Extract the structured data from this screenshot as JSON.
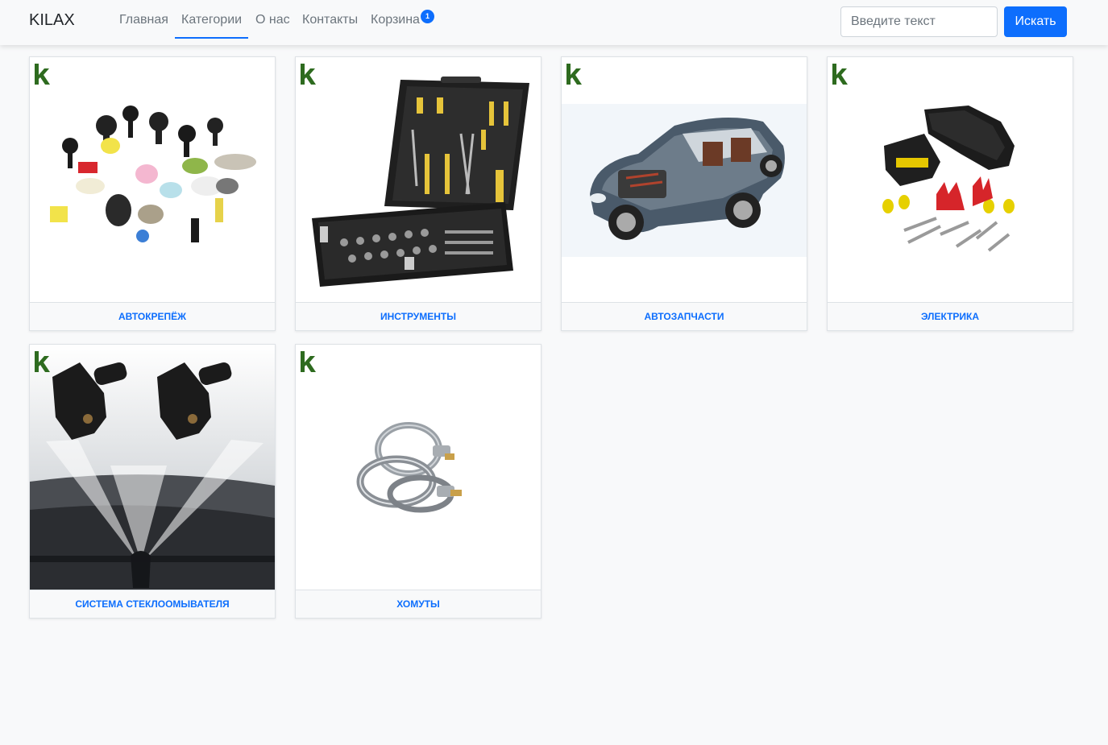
{
  "brand": "KILAX",
  "nav": {
    "home": "Главная",
    "categories": "Категории",
    "about": "О нас",
    "contacts": "Контакты",
    "cart": "Корзина",
    "cart_count": "1"
  },
  "search": {
    "placeholder": "Введите текст",
    "button": "Искать"
  },
  "categories": [
    {
      "label": "АВТОКРЕПЁЖ",
      "image": "plastic-clips-icon"
    },
    {
      "label": "ИНСТРУМЕНТЫ",
      "image": "tool-case-icon"
    },
    {
      "label": "АВТОЗАПЧАСТИ",
      "image": "car-cutaway-icon"
    },
    {
      "label": "ЭЛЕКТРИКА",
      "image": "connector-kit-icon"
    },
    {
      "label": "СИСТЕМА СТЕКЛООМЫВАТЕЛЯ",
      "image": "washer-nozzles-icon"
    },
    {
      "label": "ХОМУТЫ",
      "image": "hose-clamps-icon"
    }
  ],
  "colors": {
    "accent": "#0d6efd",
    "logo_green": "#2e6b1f",
    "background": "#f8f9fa"
  }
}
